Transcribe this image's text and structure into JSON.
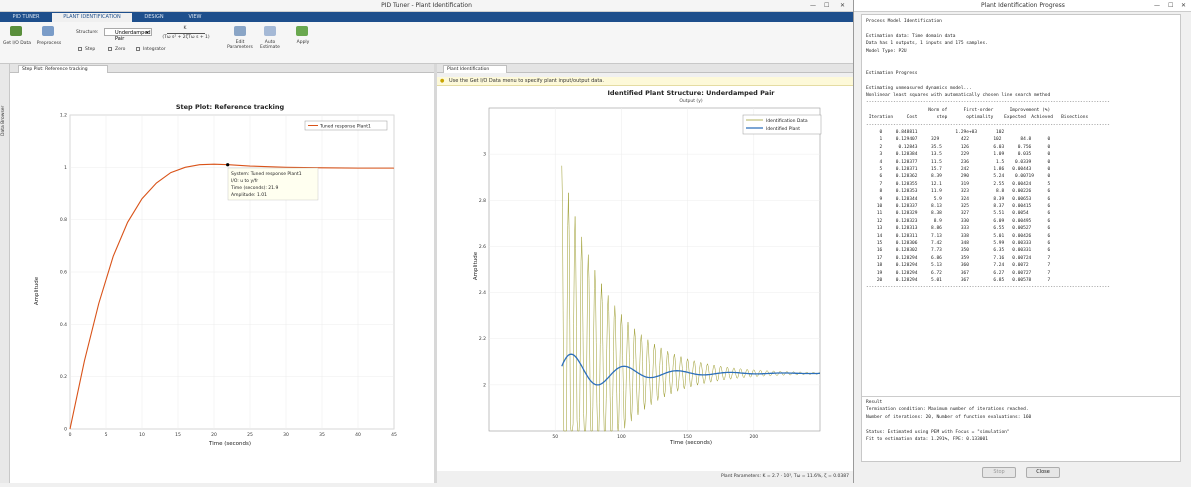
{
  "window": {
    "title": "PID Tuner - Plant Identification",
    "tabs": [
      "PID TUNER",
      "PLANT IDENTIFICATION",
      "DESIGN",
      "VIEW"
    ]
  },
  "ribbon": {
    "get_io_data": "Get I/O Data",
    "preprocess": "Preprocess",
    "structure_label": "Structure:",
    "structure_value": "Underdamped Pair",
    "tf_numerator": "K",
    "tf_denominator": "(Tω s² + 2ζTω s + 1)",
    "step": "Step",
    "zero": "Zero",
    "integrator": "Integrator",
    "edit_parameters": "Edit Parameters",
    "auto_estimate": "Auto Estimate",
    "apply": "Apply"
  },
  "left": {
    "side_label": "Data Browser",
    "doc_tab": "Step Plot: Reference tracking",
    "plot_title": "Step Plot: Reference tracking",
    "xlabel": "Time (seconds)",
    "ylabel": "Amplitude",
    "legend": "Tuned response Plant1",
    "tooltip": [
      "System: Tuned response Plant1",
      "I/O: u to y/fr",
      "Time (seconds): 21.9",
      "Amplitude: 1.01"
    ]
  },
  "right": {
    "doc_tab": "Plant Identification",
    "info": "Use the Get I/O Data menu to specify plant input/output data.",
    "plot_title": "Identified Plant Structure: Underdamped Pair",
    "subtitle": "Output (y)",
    "xlabel": "Time (seconds)",
    "ylabel": "Amplitude",
    "legend": [
      "Identification Data",
      "Identified Plant"
    ],
    "status": "Plant Parameters: K = 2.7 · 10³, Tω = 11.6%, ζ = 0.0387"
  },
  "dialog": {
    "title": "Plant Identification Progress",
    "lines": [
      "Process Model Identification",
      "",
      "Estimation data: Time domain data",
      "Data has 1 outputs, 1 inputs and 175 samples.",
      "Model Type: P2U",
      "",
      "",
      "Estimation Progress",
      "",
      "Estimating unmeasured dynamics model...",
      "Nonlinear least squares with automatically chosen line search method",
      "------------------------------------------------------------------------------------------",
      "                       Norm of      First-order      Improvement (%)",
      " Iteration     Cost       step       optimality    Expected  Achieved   Bisections",
      "------------------------------------------------------------------------------------------",
      "     0     0.848811              1.29e+03       102",
      "     1     0.129407     329        422         102       84.8      0",
      "     2      0.12843     35.5       126         6.03     0.756      0",
      "     3     0.128384     13.5       229         1.09     0.035      0",
      "     4     0.128377     11.5       236          1.5    0.0339      0",
      "     5     0.128371     15.7       242         1.86   0.00443      0",
      "     6     0.128362     8.39       290         5.24    0.00719     0",
      "     7     0.128355     12.1       319         2.55   0.00424      5",
      "     8     0.128353     11.9       323          8.8   0.00226      6",
      "     9     0.128344      5.9       324         8.39   0.00653      6",
      "    10     0.128337     8.13       325         8.37   0.00415      6",
      "    11     0.128329     8.38       327         5.51   0.0054       6",
      "    12     0.128323      8.9       330         6.09   0.00495      6",
      "    13     0.128313     8.86       333         6.55   0.00527      6",
      "    14     0.128311     7.13       338         5.01   0.00426      6",
      "    15     0.128306     7.42       348         5.99   0.00333      6",
      "    16     0.128302     7.73       350         6.35   0.00331      6",
      "    17     0.128294     6.86       359         7.16   0.00724      7",
      "    18     0.128294     5.13       360         7.24   0.0072       7",
      "    19     0.128294     6.72       367         6.27   0.00727      7",
      "    20     0.128294     5.01       367         6.85   0.00578      7",
      "------------------------------------------------------------------------------------------"
    ],
    "result_lines": [
      "Result",
      "Termination condition: Maximum number of iterations reached.",
      "Number of iterations: 20, Number of function evaluations: 160",
      "",
      "Status: Estimated using PEM with Focus = \"simulation\"",
      "Fit to estimation data: 1.291%, FPE: 0.133001"
    ],
    "stop_label": "Stop",
    "close_label": "Close"
  },
  "chart_data": [
    {
      "type": "line",
      "title": "Step Plot: Reference tracking",
      "xlabel": "Time (seconds)",
      "ylabel": "Amplitude",
      "xlim": [
        0,
        45
      ],
      "ylim": [
        0,
        1.2
      ],
      "xticks": [
        0,
        5,
        10,
        15,
        20,
        25,
        30,
        35,
        40,
        45
      ],
      "yticks": [
        0,
        0.2,
        0.4,
        0.6,
        0.8,
        1,
        1.2
      ],
      "series": [
        {
          "name": "Tuned response Plant1",
          "x": [
            0,
            2,
            4,
            6,
            8,
            10,
            12,
            14,
            16,
            18,
            20,
            22,
            25,
            30,
            35,
            40,
            45
          ],
          "y": [
            0,
            0.26,
            0.48,
            0.66,
            0.79,
            0.88,
            0.94,
            0.98,
            1.0,
            1.01,
            1.012,
            1.01,
            1.005,
            1.0,
            0.998,
            0.997,
            0.997
          ]
        }
      ],
      "marker": {
        "x": 21.9,
        "y": 1.01
      }
    },
    {
      "type": "line",
      "title": "Identified Plant Structure: Underdamped Pair",
      "xlabel": "Time (seconds)",
      "ylabel": "Amplitude",
      "xlim": [
        0,
        250
      ],
      "ylim": [
        1.8,
        3.2
      ],
      "xticks": [
        50,
        100,
        150,
        200
      ],
      "yticks": [
        2,
        2.2,
        2.4,
        2.6,
        2.8,
        3
      ],
      "series": [
        {
          "name": "Identification Data",
          "start": 55,
          "end": 250,
          "base": 2.05,
          "amp": 0.9,
          "decay": 0.028,
          "period": 5
        },
        {
          "name": "Identified Plant",
          "start": 55,
          "end": 250,
          "base": 2.05,
          "amp": 0.1,
          "decay": 0.025,
          "period": 40
        }
      ]
    }
  ]
}
